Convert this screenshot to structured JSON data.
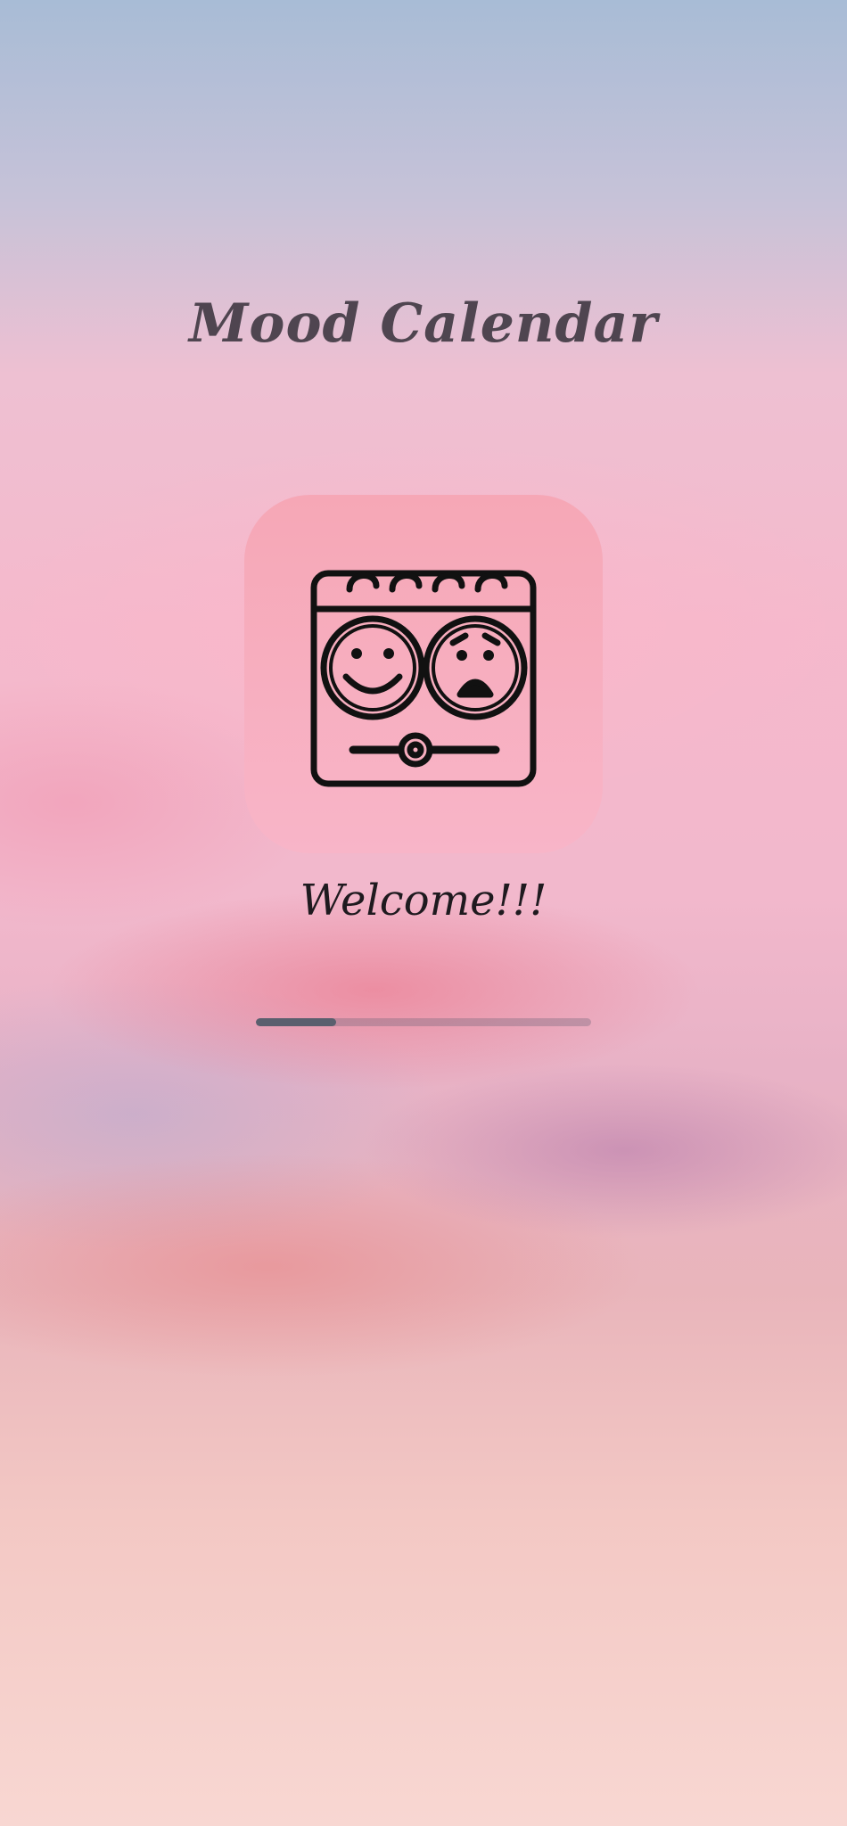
{
  "app": {
    "title": "Mood Calendar",
    "welcome": "Welcome!!!",
    "logo_icon": "mood-calendar-icon"
  },
  "loading": {
    "progress_fraction": 0.24
  },
  "colors": {
    "title": "#4f4550",
    "logo_tile": "#f6a7b6",
    "progress_fill": "#5a5f6e"
  }
}
